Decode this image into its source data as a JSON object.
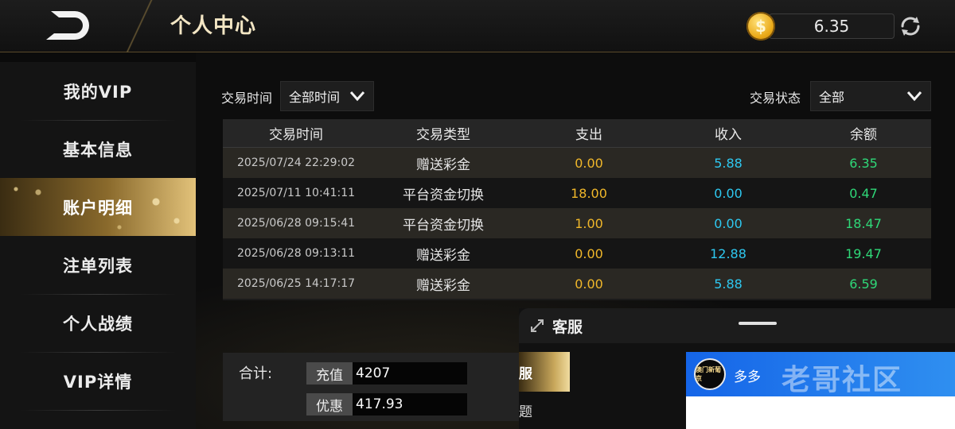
{
  "header": {
    "title": "个人中心",
    "balance": "6.35",
    "coin_symbol": "$",
    "back_icon": "back-icon",
    "refresh_icon": "refresh-icon"
  },
  "sidebar": {
    "items": [
      {
        "label": "我的VIP",
        "active": false
      },
      {
        "label": "基本信息",
        "active": false
      },
      {
        "label": "账户明细",
        "active": true
      },
      {
        "label": "注单列表",
        "active": false
      },
      {
        "label": "个人战绩",
        "active": false
      },
      {
        "label": "VIP详情",
        "active": false
      }
    ]
  },
  "filters": {
    "time_label": "交易时间",
    "time_value": "全部时间",
    "status_label": "交易状态",
    "status_value": "全部"
  },
  "table": {
    "columns": [
      "交易时间",
      "交易类型",
      "支出",
      "收入",
      "余额"
    ],
    "rows": [
      [
        "2025/07/24 22:29:02",
        "赠送彩金",
        "0.00",
        "5.88",
        "6.35"
      ],
      [
        "2025/07/11 10:41:11",
        "平台资金切换",
        "18.00",
        "0.00",
        "0.47"
      ],
      [
        "2025/06/28 09:15:41",
        "平台资金切换",
        "1.00",
        "0.00",
        "18.47"
      ],
      [
        "2025/06/28 09:13:11",
        "赠送彩金",
        "0.00",
        "12.88",
        "19.47"
      ],
      [
        "2025/06/25 14:17:17",
        "赠送彩金",
        "0.00",
        "5.88",
        "6.59"
      ]
    ]
  },
  "totals": {
    "label": "合计:",
    "recharge_label": "充值",
    "recharge_value": "4207",
    "discount_label": "优惠",
    "discount_value": "417.93"
  },
  "customer_service": {
    "title": "客服",
    "tab_active": "服",
    "tab_other": "题",
    "agent_name": "多多",
    "avatar_text": "澳门新葡京",
    "watermark": "老哥社区"
  },
  "colors": {
    "expense": "#f0b72a",
    "income": "#2ec8f0",
    "balance": "#2fd878",
    "accent_gold": "#c9a85c"
  }
}
